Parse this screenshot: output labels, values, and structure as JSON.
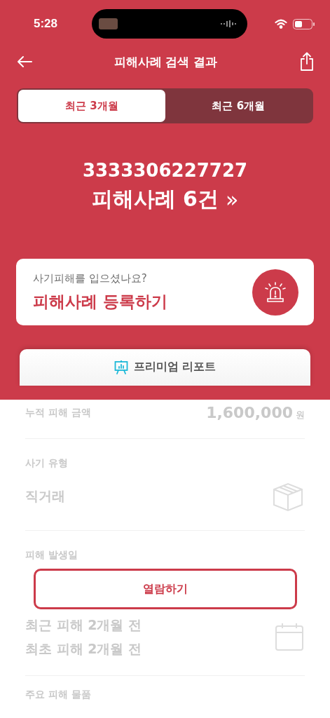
{
  "status_bar": {
    "time": "5:28"
  },
  "header": {
    "title": "피해사례 검색 결과"
  },
  "tabs": [
    {
      "label": "최근 3개월",
      "selected": true
    },
    {
      "label": "최근 6개월",
      "selected": false
    }
  ],
  "summary": {
    "number": "3333306227727",
    "count": "피해사례 6건",
    "chevron": "»"
  },
  "report_card": {
    "question": "사기피해를 입으셨나요?",
    "action": "피해사례 등록하기"
  },
  "premium": {
    "title": "프리미엄 리포트",
    "button": "열람하기",
    "rows": [
      {
        "kind": "amount",
        "label": "누적 피해 금액",
        "value": "1,600,000",
        "unit": "원"
      },
      {
        "kind": "type",
        "label": "사기 유형",
        "value": "직거래"
      },
      {
        "kind": "dates",
        "label": "피해 발생일",
        "lines": [
          "최근 피해 2개월 전",
          "최초 피해 2개월 전"
        ]
      },
      {
        "kind": "items",
        "label": "주요 피해 물품"
      }
    ]
  }
}
